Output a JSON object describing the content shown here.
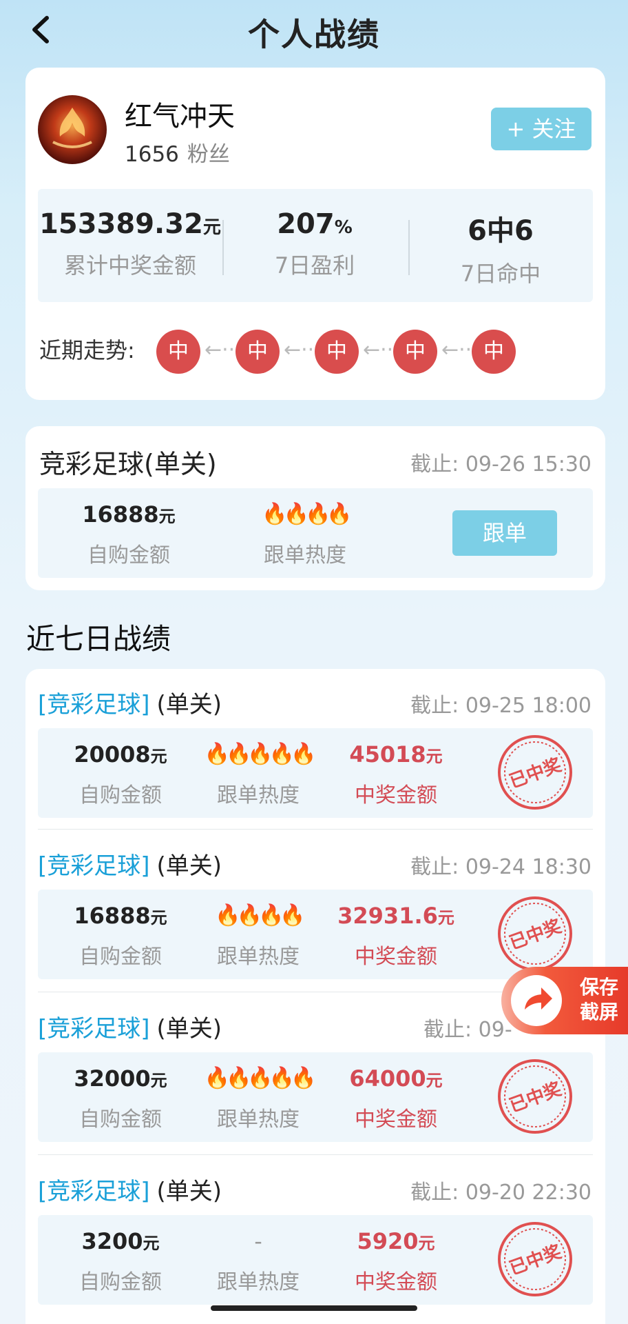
{
  "header": {
    "title": "个人战绩"
  },
  "profile": {
    "name": "红气冲天",
    "fans_count": "1656",
    "fans_label": "粉丝",
    "follow_label": "+ 关注",
    "stats": [
      {
        "value": "153389.32",
        "unit": "元",
        "label": "累计中奖金额"
      },
      {
        "value": "207",
        "unit": "%",
        "label": "7日盈利"
      },
      {
        "value": "6中6",
        "unit": "",
        "label": "7日命中"
      }
    ],
    "trend_label": "近期走势:",
    "trend": [
      "中",
      "中",
      "中",
      "中",
      "中"
    ],
    "trend_arrow": "←···"
  },
  "current_order": {
    "category": "竞彩足球(单关)",
    "deadline_label": "截止:",
    "deadline": "09-26 15:30",
    "amount": "16888",
    "unit": "元",
    "amount_label": "自购金额",
    "heat": "🔥🔥🔥🔥",
    "heat_label": "跟单热度",
    "follow_button": "跟单"
  },
  "history": {
    "title": "近七日战绩",
    "records": [
      {
        "category": "[竞彩足球]",
        "type": "(单关)",
        "deadline_label": "截止:",
        "deadline": "09-25 18:00",
        "amount": "20008",
        "unit": "元",
        "amount_label": "自购金额",
        "heat": "🔥🔥🔥🔥🔥",
        "heat_label": "跟单热度",
        "win": "45018",
        "win_label": "中奖金额",
        "stamp": "已中奖"
      },
      {
        "category": "[竞彩足球]",
        "type": "(单关)",
        "deadline_label": "截止:",
        "deadline": "09-24 18:30",
        "amount": "16888",
        "unit": "元",
        "amount_label": "自购金额",
        "heat": "🔥🔥🔥🔥",
        "heat_label": "跟单热度",
        "win": "32931.6",
        "win_label": "中奖金额",
        "stamp": "已中奖"
      },
      {
        "category": "[竞彩足球]",
        "type": "(单关)",
        "deadline_label": "截止:",
        "deadline": "09-",
        "amount": "32000",
        "unit": "元",
        "amount_label": "自购金额",
        "heat": "🔥🔥🔥🔥🔥",
        "heat_label": "跟单热度",
        "win": "64000",
        "win_label": "中奖金额",
        "stamp": "已中奖"
      },
      {
        "category": "[竞彩足球]",
        "type": "(单关)",
        "deadline_label": "截止:",
        "deadline": "09-20 22:30",
        "amount": "3200",
        "unit": "元",
        "amount_label": "自购金额",
        "heat": "-",
        "heat_label": "跟单热度",
        "win": "5920",
        "win_label": "中奖金额",
        "stamp": "已中奖"
      }
    ]
  },
  "floating": {
    "save_label_1": "保存",
    "save_label_2": "截屏"
  },
  "colors": {
    "accent": "#7ccfe6",
    "red": "#d34b55",
    "trend_red": "#d94d4d",
    "link_blue": "#1aa0d8"
  }
}
